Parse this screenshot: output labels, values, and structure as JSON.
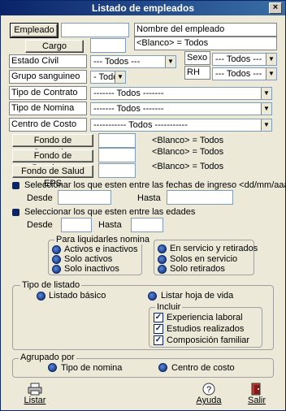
{
  "window": {
    "title": "Listado de empleados",
    "close_glyph": "×"
  },
  "filters": {
    "empleado_label": "Empleado",
    "empleado_value": "",
    "empleado_name": "Nombre del empleado",
    "cargo_label": "Cargo",
    "cargo_value": "",
    "cargo_name": "<Blanco> = Todos",
    "estado_civil_label": "Estado Civil",
    "estado_civil_value": "--- Todos ---",
    "sexo_label": "Sexo",
    "sexo_value": "--- Todos ---",
    "grupo_label": "Grupo sanguineo",
    "grupo_value": "- Todos -",
    "rh_label": "RH",
    "rh_value": "--- Todos ---",
    "contrato_label": "Tipo de Contrato",
    "contrato_value": "------- Todos -------",
    "nomina_label": "Tipo de Nomina",
    "nomina_value": "------- Todos -------",
    "costo_label": "Centro de Costo",
    "costo_value": "----------- Todos -----------",
    "cesantias_label": "Fondo de Cesantias",
    "cesantias_value": "",
    "cesantias_name": "<Blanco> = Todos",
    "pensiones_label": "Fondo de Pensiones",
    "pensiones_value": "",
    "pensiones_name": "<Blanco> = Todos",
    "salud_label": "Fondo de Salud EPS",
    "salud_value": "",
    "salud_name": "<Blanco> = Todos"
  },
  "fechas": {
    "label": "Seleccionar los que esten entre las fechas de ingreso   <dd/mm/aaaa>",
    "desde_label": "Desde",
    "desde_value": "",
    "hasta_label": "Hasta",
    "hasta_value": ""
  },
  "edades": {
    "label": "Seleccionar los que esten entre las edades",
    "desde_label": "Desde",
    "desde_value": "",
    "hasta_label": "Hasta",
    "hasta_value": ""
  },
  "liquidar": {
    "title": "Para liquidarles nomina",
    "options": [
      "Activos e inactivos",
      "Solo activos",
      "Solo inactivos"
    ],
    "selected": 0
  },
  "servicio": {
    "options": [
      "En servicio y retirados",
      "Solos en servicio",
      "Solo retirados"
    ],
    "selected": 0
  },
  "tipo_listado": {
    "title": "Tipo de listado",
    "basico": "Listado básico",
    "hoja_vida": "Listar hoja de vida",
    "incluir_title": "Incluir",
    "incluir": [
      "Experiencia laboral",
      "Estudios realizados",
      "Composición familiar"
    ]
  },
  "agrupado": {
    "title": "Agrupado por",
    "nomina": "Tipo de nomina",
    "costo": "Centro de costo"
  },
  "toolbar": {
    "listar_label": "Listar",
    "ayuda_label": "Ayuda",
    "salir_label": "Salir"
  },
  "colors": {
    "title_bg": "#0a246a",
    "window_bg": "#ece9d8",
    "accent": "#0a246a"
  }
}
